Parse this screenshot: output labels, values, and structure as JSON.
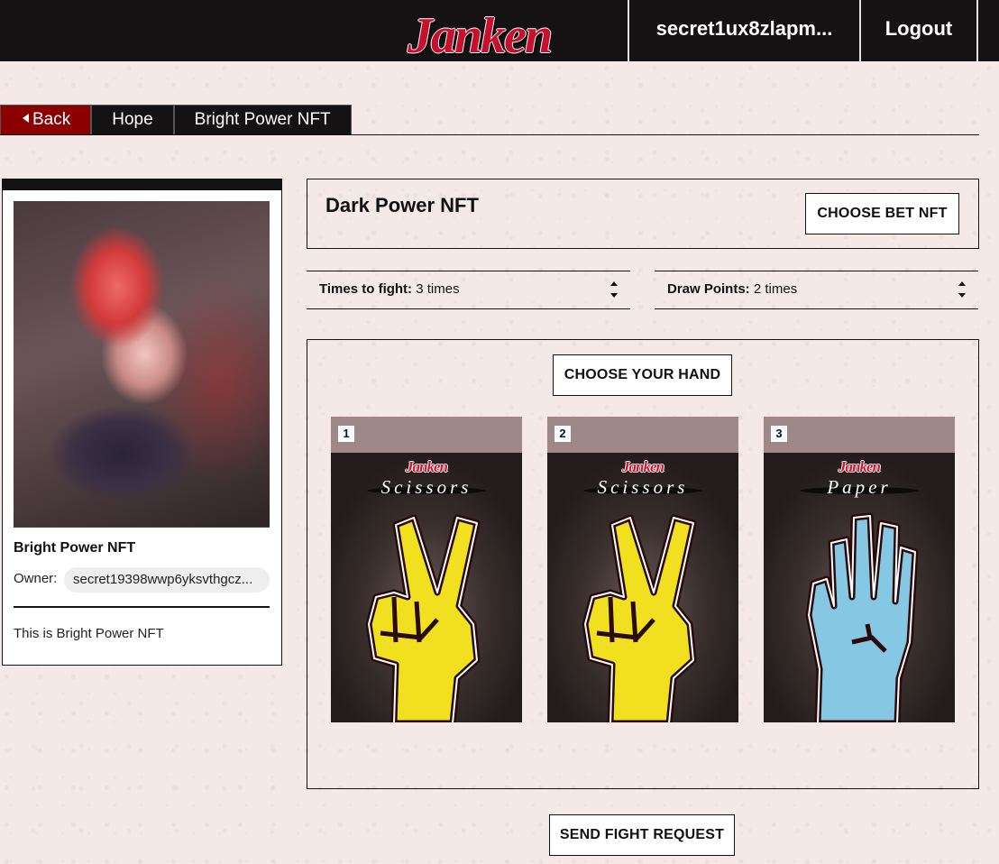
{
  "header": {
    "logo_text": "Janken",
    "wallet_address": "secret1ux8zlapm...",
    "logout_label": "Logout"
  },
  "breadcrumb": {
    "back_label": "Back",
    "items": [
      "Hope",
      "Bright Power NFT"
    ]
  },
  "nft_card": {
    "title": "Bright Power NFT",
    "owner_label": "Owner:",
    "owner_value": "secret19398wwp6yksvthgcz...",
    "description": "This is Bright Power NFT"
  },
  "bet": {
    "title": "Dark Power NFT",
    "choose_button": "CHOOSE BET NFT"
  },
  "times_to_fight": {
    "label": "Times to fight:",
    "value": "3 times"
  },
  "draw_points": {
    "label": "Draw Points:",
    "value": "2 times"
  },
  "hands": {
    "choose_button": "CHOOSE YOUR HAND",
    "cards": [
      {
        "number": "1",
        "logo": "Janken",
        "name": "Scissors",
        "icon": "scissors-hand-icon",
        "color": "#f0e020"
      },
      {
        "number": "2",
        "logo": "Janken",
        "name": "Scissors",
        "icon": "scissors-hand-icon",
        "color": "#f0e020"
      },
      {
        "number": "3",
        "logo": "Janken",
        "name": "Paper",
        "icon": "paper-hand-icon",
        "color": "#86c8e4"
      }
    ]
  },
  "send_button": "SEND FIGHT REQUEST",
  "colors": {
    "header_bg": "#141212",
    "back_bg": "#8b0000",
    "logo_red": "#c8102e",
    "page_bg": "#f5e9e7"
  }
}
